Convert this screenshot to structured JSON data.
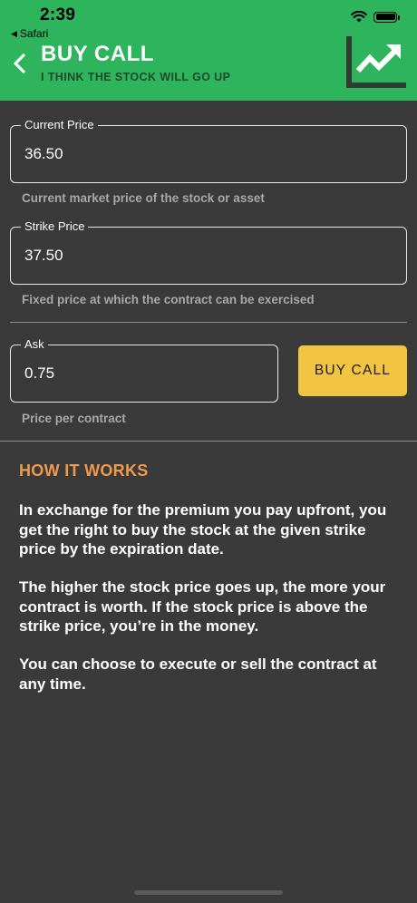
{
  "status_bar": {
    "time": "2:39",
    "back_app": "Safari"
  },
  "header": {
    "title": "BUY CALL",
    "subtitle": "I THINK THE STOCK WILL GO UP",
    "icon": "trending-up-chart-icon",
    "color": "#2fb45e"
  },
  "form": {
    "current_price": {
      "label": "Current Price",
      "value": "36.50",
      "helper": "Current market price of the stock or asset"
    },
    "strike_price": {
      "label": "Strike Price",
      "value": "37.50",
      "helper": "Fixed price at which the contract can be exercised"
    },
    "ask": {
      "label": "Ask",
      "value": "0.75",
      "helper": "Price per contract"
    },
    "buy_button": "BUY CALL"
  },
  "how_it_works": {
    "title": "HOW IT WORKS",
    "paragraphs": [
      "In exchange for the premium you pay upfront, you get the right to buy the stock at the given strike price by the expiration date.",
      "The higher the stock price goes up, the more your contract is worth. If the stock price is above the strike price, you’re in the money.",
      "You can choose to execute or sell the contract at any time."
    ]
  },
  "colors": {
    "accent_green": "#2fb45e",
    "button_yellow": "#f1c542",
    "section_orange": "#ee9a4d",
    "background": "#3a3a3a"
  }
}
